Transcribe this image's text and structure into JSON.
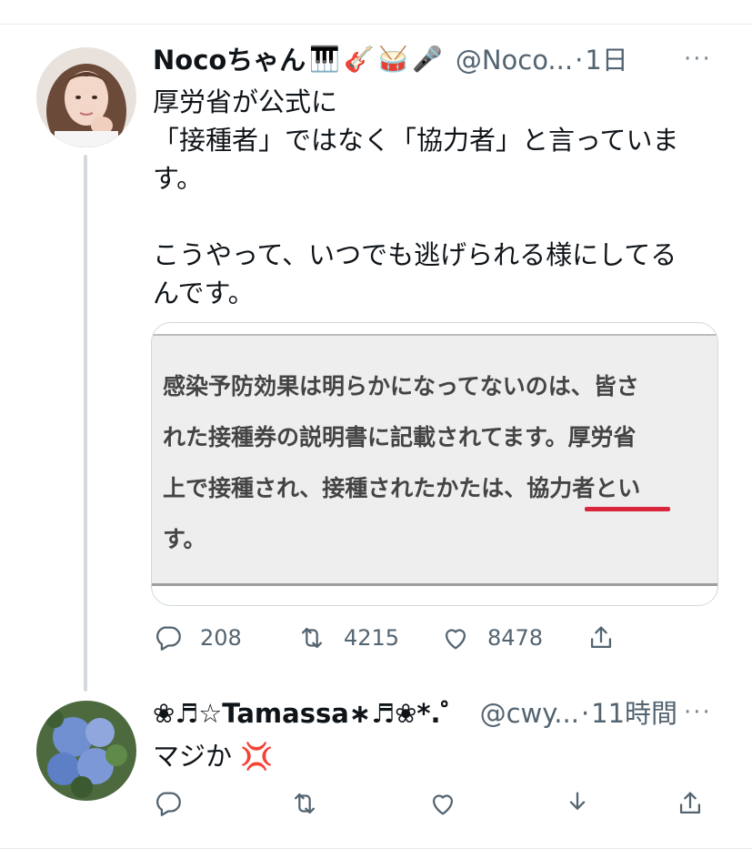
{
  "tweet": {
    "author_name": "Nocoちゃん",
    "name_emojis": [
      "🎹",
      "🎸",
      "🥁",
      "🎤"
    ],
    "handle": "@Noco...",
    "separator": "·",
    "time": "1日",
    "text": "厚労省が公式に\n「接種者」ではなく「協力者」と言っていま\nす。\n\nこうやって、いつでも逃げられる様にしてる\nんです。",
    "media_text": "感染予防効果は明らかになってないのは、皆さ\nれた接種券の説明書に記載されてます。厚労省\n上で接種され、接種されたかたは、協力者とい\nす。",
    "actions": {
      "reply_count": "208",
      "retweet_count": "4215",
      "like_count": "8478"
    },
    "more": "···"
  },
  "reply": {
    "author_name": "❀♬☆Tamassa∗♬❀*.゜",
    "handle": "@cwy...",
    "separator": "·",
    "time": "11時間",
    "text": "マジか 💢",
    "more": "···"
  },
  "icons": {
    "reply": "reply-icon",
    "retweet": "retweet-icon",
    "like": "like-icon",
    "share": "share-icon",
    "bookmark": "download-icon"
  },
  "colors": {
    "text": "#0f1419",
    "secondary": "#536471",
    "divider": "#e6e9ec",
    "underline": "#d9263d"
  }
}
